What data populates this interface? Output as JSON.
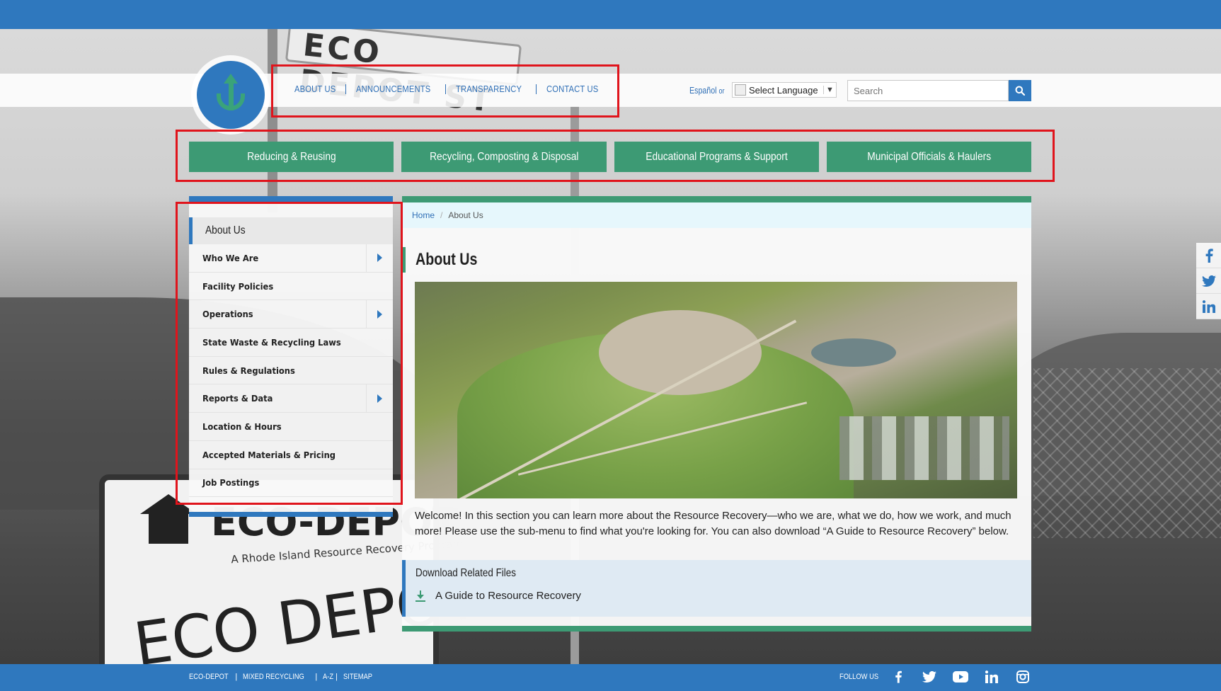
{
  "utility_nav": {
    "items": [
      "ABOUT US",
      "ANNOUNCEMENTS",
      "TRANSPARENCY",
      "CONTACT US"
    ]
  },
  "language": {
    "espanol_label": "Español",
    "or_label": "or",
    "select_label": "Select Language"
  },
  "search": {
    "placeholder": "Search"
  },
  "main_nav": {
    "items": [
      "Reducing & Reusing",
      "Recycling, Composting & Disposal",
      "Educational Programs & Support",
      "Municipal Officials & Haulers"
    ]
  },
  "sidebar": {
    "heading": "About Us",
    "items": [
      {
        "label": "Who We Are",
        "has_submenu": true
      },
      {
        "label": "Facility Policies",
        "has_submenu": false
      },
      {
        "label": "Operations",
        "has_submenu": true
      },
      {
        "label": "State Waste & Recycling Laws",
        "has_submenu": false
      },
      {
        "label": "Rules & Regulations",
        "has_submenu": false
      },
      {
        "label": "Reports & Data",
        "has_submenu": true
      },
      {
        "label": "Location & Hours",
        "has_submenu": false
      },
      {
        "label": "Accepted Materials & Pricing",
        "has_submenu": false
      },
      {
        "label": "Job Postings",
        "has_submenu": false
      }
    ]
  },
  "breadcrumb": {
    "home": "Home",
    "current": "About Us"
  },
  "content": {
    "title": "About Us",
    "welcome": "Welcome! In this section you can learn more about the Resource Recovery—who we are, what we do, how we work, and much more!  Please use the sub-menu to find what you're looking for.  You can also download “A Guide to Resource Recovery” below.",
    "downloads_title": "Download Related Files",
    "download_item": "A Guide to Resource Recovery"
  },
  "background_sign": {
    "street_sign": "ECO DEPOT ST",
    "title": "ECO-DEPOT",
    "subtitle": "A Rhode Island Resource Recovery Program",
    "big_text": "ECO DEPOT"
  },
  "footer": {
    "links": [
      "ECO-DEPOT",
      "MIXED RECYCLING",
      "A-Z",
      "SITEMAP"
    ],
    "follow_label": "FOLLOW US",
    "social_icons": [
      "facebook-icon",
      "twitter-icon",
      "youtube-icon",
      "linkedin-icon",
      "instagram-icon"
    ]
  },
  "side_social": {
    "icons": [
      "facebook-icon",
      "twitter-icon",
      "linkedin-icon"
    ]
  },
  "colors": {
    "brand_blue": "#2f78be",
    "brand_green": "#3d9a74",
    "highlight_red": "#e0141c",
    "breadcrumb_bg": "#e6f7fc"
  }
}
